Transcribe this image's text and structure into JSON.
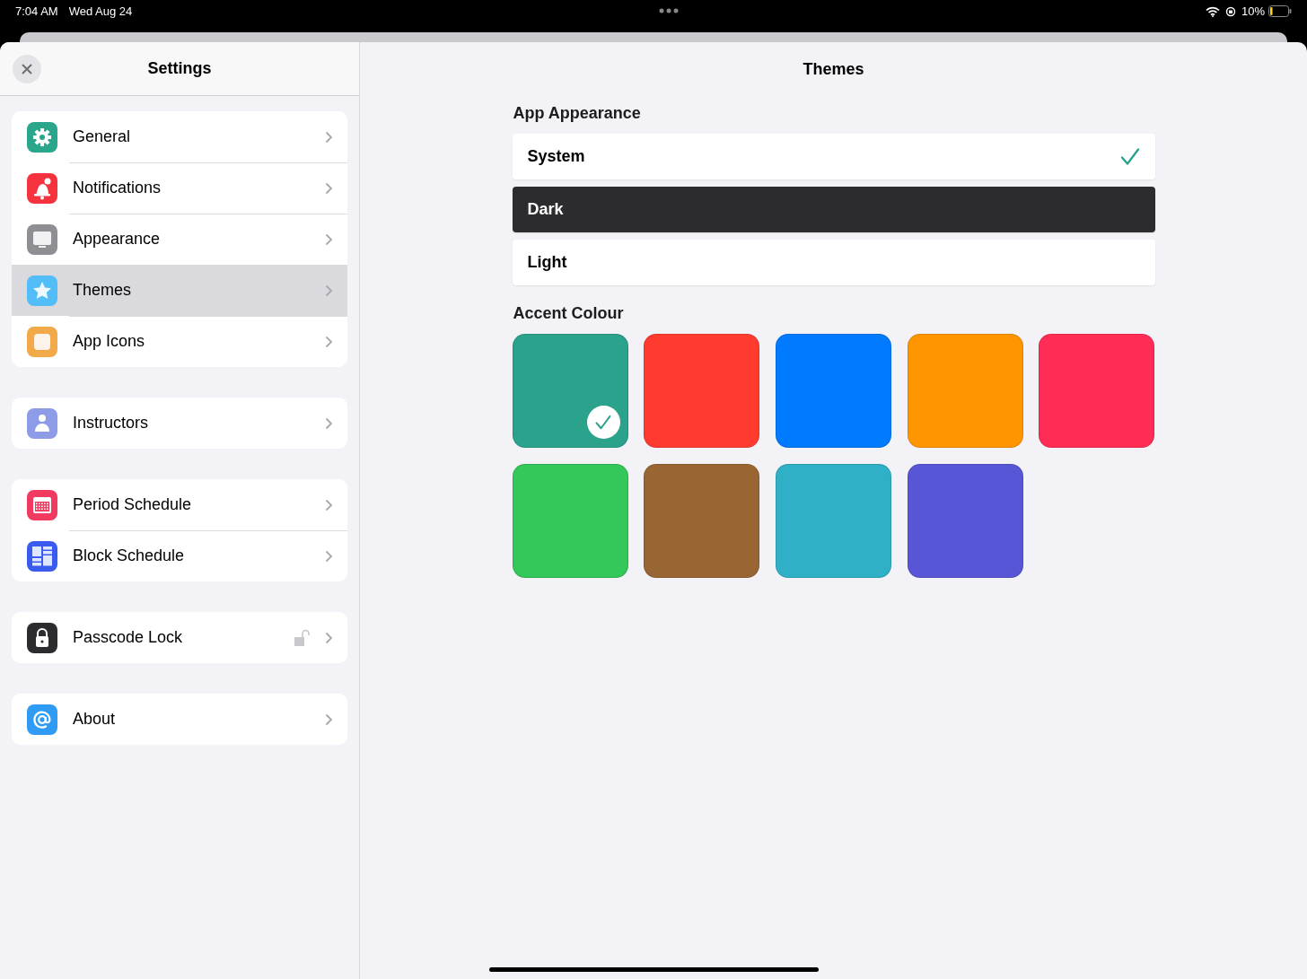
{
  "status_bar": {
    "time": "7:04 AM",
    "date": "Wed Aug 24",
    "battery": "10%"
  },
  "sidebar": {
    "title": "Settings",
    "groups": [
      [
        {
          "label": "General",
          "kind": "gear",
          "selected": false
        },
        {
          "label": "Notifications",
          "kind": "bell",
          "selected": false
        },
        {
          "label": "Appearance",
          "kind": "display",
          "selected": false
        },
        {
          "label": "Themes",
          "kind": "star",
          "selected": true
        },
        {
          "label": "App Icons",
          "kind": "square",
          "selected": false
        }
      ],
      [
        {
          "label": "Instructors",
          "kind": "person",
          "selected": false
        }
      ],
      [
        {
          "label": "Period Schedule",
          "kind": "calendar",
          "selected": false
        },
        {
          "label": "Block Schedule",
          "kind": "blocks",
          "selected": false
        }
      ],
      [
        {
          "label": "Passcode Lock",
          "kind": "lock",
          "selected": false,
          "locked": false
        }
      ],
      [
        {
          "label": "About",
          "kind": "at",
          "selected": false
        }
      ]
    ]
  },
  "detail": {
    "title": "Themes",
    "appearance": {
      "heading": "App Appearance",
      "options": [
        {
          "label": "System",
          "kind": "light",
          "selected": true
        },
        {
          "label": "Dark",
          "kind": "dark",
          "selected": false
        },
        {
          "label": "Light",
          "kind": "light",
          "selected": false
        }
      ]
    },
    "accent": {
      "heading": "Accent Colour",
      "swatches": [
        {
          "color": "#2ba28b",
          "selected": true
        },
        {
          "color": "#ff3b30",
          "selected": false
        },
        {
          "color": "#007aff",
          "selected": false
        },
        {
          "color": "#ff9500",
          "selected": false
        },
        {
          "color": "#ff2d55",
          "selected": false
        },
        {
          "color": "#34c759",
          "selected": false
        },
        {
          "color": "#996633",
          "selected": false
        },
        {
          "color": "#30b0c7",
          "selected": false
        },
        {
          "color": "#5856d6",
          "selected": false
        }
      ]
    }
  }
}
